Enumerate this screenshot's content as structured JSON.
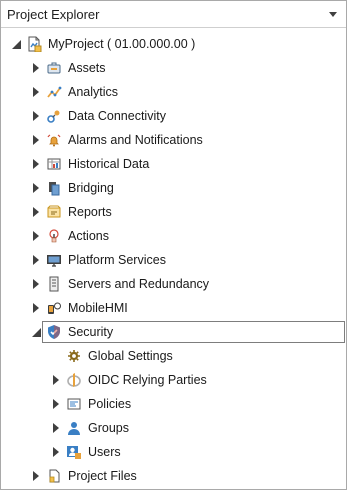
{
  "panel": {
    "title": "Project Explorer"
  },
  "tree": {
    "root": {
      "label": "MyProject ( 01.00.000.00 )",
      "icon": "project-file-icon",
      "state": "expanded"
    },
    "items": [
      {
        "label": "Assets",
        "icon": "assets-icon",
        "state": "collapsed"
      },
      {
        "label": "Analytics",
        "icon": "analytics-icon",
        "state": "collapsed"
      },
      {
        "label": "Data Connectivity",
        "icon": "data-connectivity-icon",
        "state": "collapsed"
      },
      {
        "label": "Alarms and Notifications",
        "icon": "alarm-icon",
        "state": "collapsed"
      },
      {
        "label": "Historical Data",
        "icon": "historical-data-icon",
        "state": "collapsed"
      },
      {
        "label": "Bridging",
        "icon": "bridging-icon",
        "state": "collapsed"
      },
      {
        "label": "Reports",
        "icon": "reports-icon",
        "state": "collapsed"
      },
      {
        "label": "Actions",
        "icon": "actions-icon",
        "state": "collapsed"
      },
      {
        "label": "Platform Services",
        "icon": "monitor-icon",
        "state": "collapsed"
      },
      {
        "label": "Servers and Redundancy",
        "icon": "server-icon",
        "state": "collapsed"
      },
      {
        "label": "MobileHMI",
        "icon": "mobile-icon",
        "state": "collapsed"
      },
      {
        "label": "Security",
        "icon": "shield-icon",
        "state": "expanded",
        "selected": true,
        "children": [
          {
            "label": "Global Settings",
            "icon": "gear-icon",
            "state": "leaf"
          },
          {
            "label": "OIDC Relying Parties",
            "icon": "openid-icon",
            "state": "collapsed"
          },
          {
            "label": "Policies",
            "icon": "policy-icon",
            "state": "collapsed"
          },
          {
            "label": "Groups",
            "icon": "group-icon",
            "state": "collapsed"
          },
          {
            "label": "Users",
            "icon": "users-icon",
            "state": "collapsed"
          }
        ]
      },
      {
        "label": "Project Files",
        "icon": "project-files-icon",
        "state": "collapsed"
      }
    ]
  },
  "colors": {
    "text": "#1a1a1a",
    "border": "#a9a9a9",
    "accent_orange": "#e8a23c",
    "accent_blue": "#3a7fc4",
    "glyph": "#404040"
  }
}
